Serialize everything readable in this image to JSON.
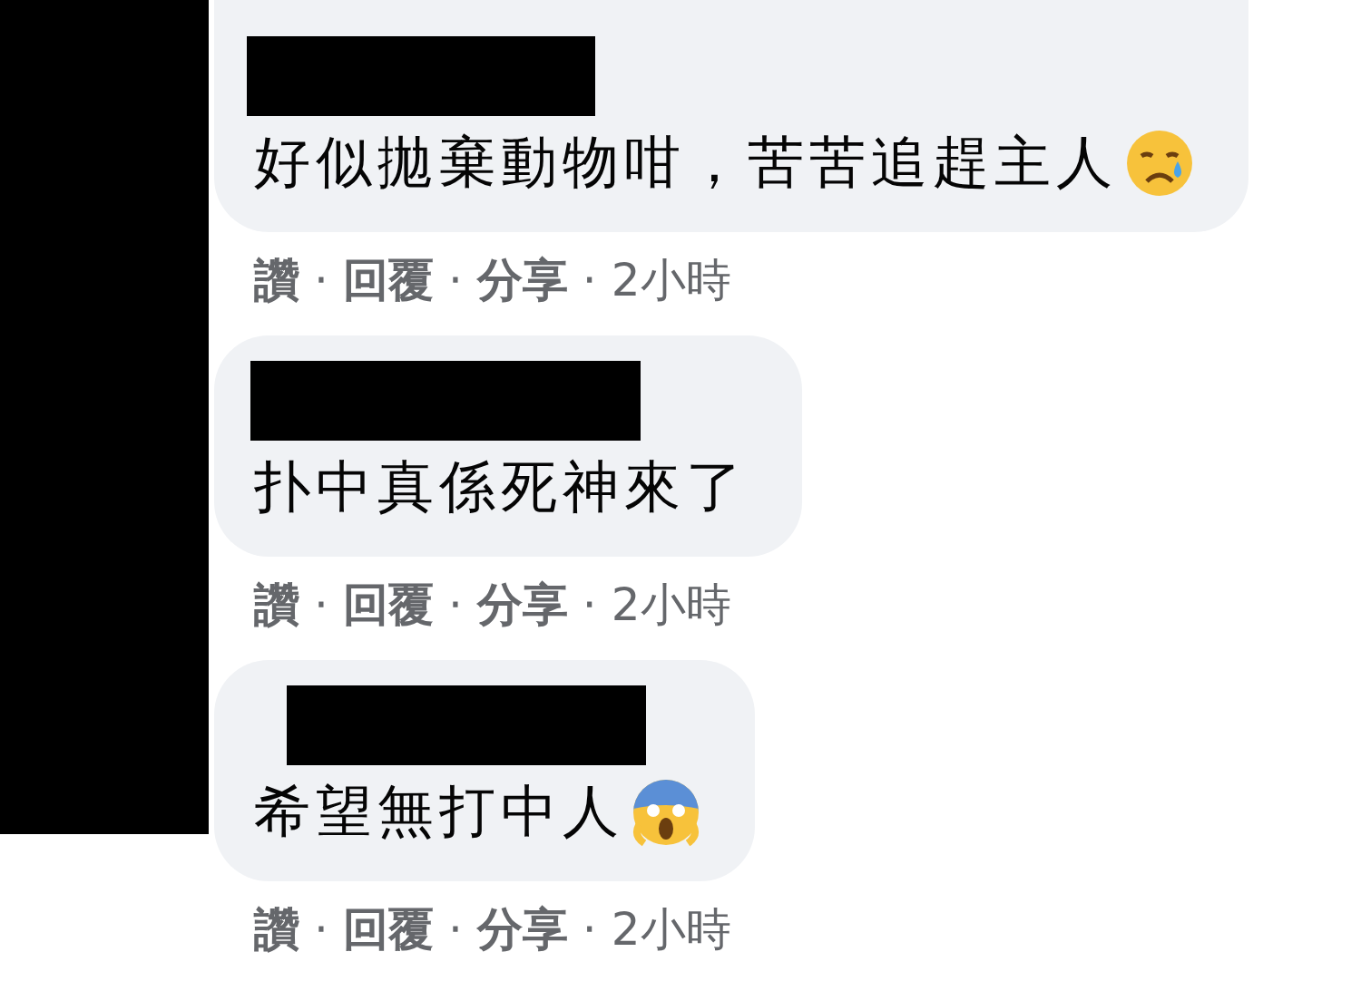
{
  "separator": "·",
  "comments": [
    {
      "kind": "crying",
      "author": {
        "redacted": true
      },
      "text": "好似拋棄動物咁，苦苦追趕主人",
      "actions": [
        "讚",
        "回覆",
        "分享"
      ],
      "time": "2小時"
    },
    {
      "kind": "plain",
      "author": {
        "redacted": true
      },
      "text": "扑中真係死神來了",
      "actions": [
        "讚",
        "回覆",
        "分享"
      ],
      "time": "2小時"
    },
    {
      "kind": "screaming",
      "author": {
        "redacted": true
      },
      "text": "希望無打中人",
      "actions": [
        "讚",
        "回覆",
        "分享"
      ],
      "time": "2小時"
    }
  ]
}
